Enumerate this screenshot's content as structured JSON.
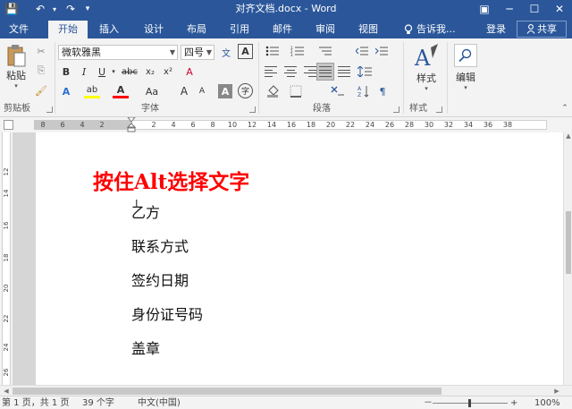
{
  "window": {
    "title": "对齐文档.docx - Word",
    "controls": {
      "minimize": "─",
      "restore": "☐",
      "close": "✕",
      "ribbon_options": "▣"
    }
  },
  "quick_access": {
    "save": "💾",
    "undo": "↶",
    "redo": "↷",
    "customize": "▾"
  },
  "tabs": [
    {
      "label": "文件"
    },
    {
      "label": "开始"
    },
    {
      "label": "插入"
    },
    {
      "label": "设计"
    },
    {
      "label": "布局"
    },
    {
      "label": "引用"
    },
    {
      "label": "邮件"
    },
    {
      "label": "审阅"
    },
    {
      "label": "视图"
    }
  ],
  "active_tab": "开始",
  "tell_me": {
    "label": "告诉我...",
    "icon": "lightbulb-icon"
  },
  "login": "登录",
  "share": "共享",
  "ribbon": {
    "clipboard": {
      "label": "剪贴板",
      "paste": "粘贴",
      "cut": "✂",
      "copy": "⎘",
      "format_painter": "🖌"
    },
    "font": {
      "label": "字体",
      "font_name": "微软雅黑",
      "font_size": "四号",
      "wen": "文",
      "char_border": "A",
      "bold": "B",
      "italic": "I",
      "underline": "U",
      "strike": "abc",
      "subscript": "x₂",
      "superscript": "x²",
      "clear": "A",
      "text_effects": "A",
      "highlight": "ab",
      "font_color": "A",
      "change_case": "Aa",
      "grow": "A",
      "shrink": "A",
      "char_shading": "A",
      "enclose": "字"
    },
    "paragraph": {
      "label": "段落"
    },
    "styles": {
      "label": "样式",
      "button": "样式"
    },
    "editing": {
      "button": "编辑"
    }
  },
  "ruler": {
    "left_numbers": [
      "8",
      "6",
      "4",
      "2"
    ],
    "right_numbers": [
      "2",
      "4",
      "6",
      "8",
      "10",
      "12",
      "14",
      "16",
      "18",
      "20",
      "22",
      "24",
      "26",
      "28",
      "30",
      "32",
      "34",
      "36",
      "38"
    ]
  },
  "vruler": {
    "numbers": [
      "12",
      "14",
      "16",
      "18",
      "20",
      "22",
      "24",
      "26"
    ]
  },
  "document": {
    "title": "按住Alt选择文字",
    "lines": [
      "乙方",
      "联系方式",
      "签约日期",
      "身份证号码",
      "盖章"
    ]
  },
  "status_bar": {
    "page": "第 1 页，共 1 页",
    "words": "39 个字",
    "language": "中文(中国)",
    "zoom_minus": "－",
    "zoom_plus": "+",
    "zoom": "100%"
  },
  "colors": {
    "brand": "#2b579a",
    "title_red": "#ff0000"
  }
}
